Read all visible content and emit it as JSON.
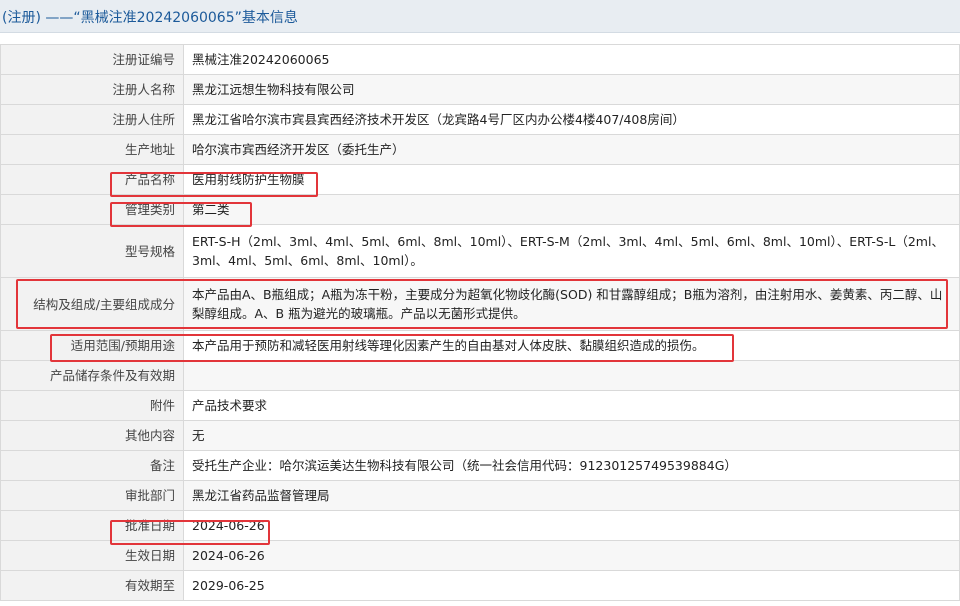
{
  "header": {
    "title": "(注册) ——“黑械注准20242060065”基本信息"
  },
  "rows": [
    {
      "label": "注册证编号",
      "value": "黑械注准20242060065"
    },
    {
      "label": "注册人名称",
      "value": "黑龙江远想生物科技有限公司"
    },
    {
      "label": "注册人住所",
      "value": "黑龙江省哈尔滨市宾县宾西经济技术开发区（龙宾路4号厂区内办公楼4楼407/408房间）"
    },
    {
      "label": "生产地址",
      "value": "哈尔滨市宾西经济开发区（委托生产）"
    },
    {
      "label": "产品名称",
      "value": "医用射线防护生物膜"
    },
    {
      "label": "管理类别",
      "value": "第二类"
    },
    {
      "label": "型号规格",
      "value": "ERT-S-H（2ml、3ml、4ml、5ml、6ml、8ml、10ml）、ERT-S-M（2ml、3ml、4ml、5ml、6ml、8ml、10ml）、ERT-S-L（2ml、3ml、4ml、5ml、6ml、8ml、10ml）。"
    },
    {
      "label": "结构及组成/主要组成成分",
      "value": "本产品由A、B瓶组成；A瓶为冻干粉，主要成分为超氧化物歧化酶(SOD) 和甘露醇组成；B瓶为溶剂，由注射用水、姜黄素、丙二醇、山梨醇组成。A、B 瓶为避光的玻璃瓶。产品以无菌形式提供。"
    },
    {
      "label": "适用范围/预期用途",
      "value": "本产品用于预防和减轻医用射线等理化因素产生的自由基对人体皮肤、黏膜组织造成的损伤。"
    },
    {
      "label": "产品储存条件及有效期",
      "value": ""
    },
    {
      "label": "附件",
      "value": "产品技术要求"
    },
    {
      "label": "其他内容",
      "value": "无"
    },
    {
      "label": "备注",
      "value": "受托生产企业：哈尔滨运美达生物科技有限公司（统一社会信用代码：91230125749539884G）"
    },
    {
      "label": "审批部门",
      "value": "黑龙江省药品监督管理局"
    },
    {
      "label": "批准日期",
      "value": "2024-06-26"
    },
    {
      "label": "生效日期",
      "value": "2024-06-26"
    },
    {
      "label": "有效期至",
      "value": "2029-06-25"
    }
  ],
  "colors": {
    "highlight": "#e2353a",
    "header_text": "#1c5a9a",
    "label_bg": "#f2f2f2"
  }
}
